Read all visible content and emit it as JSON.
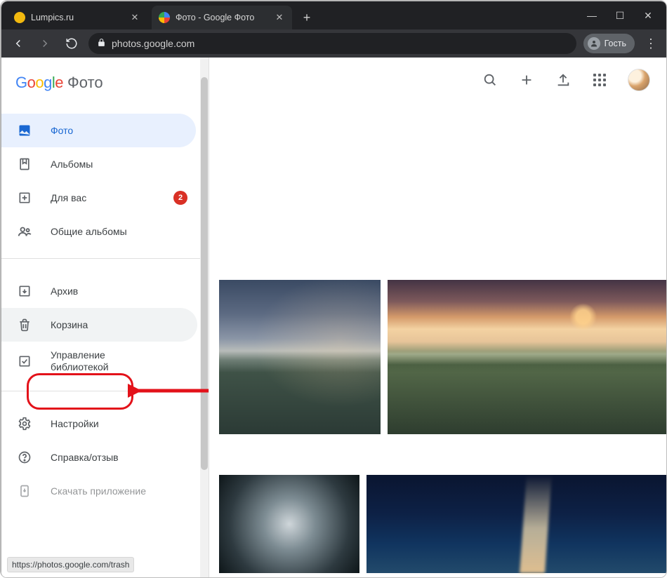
{
  "window": {
    "tabs": [
      {
        "title": "Lumpics.ru",
        "favicon_color": "#f2b90f"
      },
      {
        "title": "Фото - Google Фото",
        "favicon_color": "#ffffff"
      }
    ],
    "controls": {
      "min": "—",
      "max": "☐",
      "close": "✕"
    },
    "newtab": "+"
  },
  "address": {
    "back": "←",
    "forward": "→",
    "reload": "⟳",
    "lock": "🔒",
    "url": "photos.google.com",
    "guest_label": "Гость",
    "menu_glyph": "⋮"
  },
  "app": {
    "logo_primary": "Google",
    "logo_secondary": "Фото",
    "header_icons": {
      "search": "search-icon",
      "add": "add-icon",
      "upload": "upload-icon",
      "apps": "apps-icon",
      "avatar": "avatar"
    }
  },
  "sidebar": {
    "items": [
      {
        "label": "Фото",
        "icon": "image-icon",
        "active": true
      },
      {
        "label": "Альбомы",
        "icon": "bookmark-icon"
      },
      {
        "label": "Для вас",
        "icon": "plus-box-icon",
        "badge": "2"
      },
      {
        "label": "Общие альбомы",
        "icon": "group-icon"
      }
    ],
    "items2": [
      {
        "label": "Архив",
        "icon": "archive-icon"
      },
      {
        "label": "Корзина",
        "icon": "trash-icon",
        "highlighted": true
      },
      {
        "label": "Управление библиотекой",
        "icon": "check-box-icon"
      }
    ],
    "items3": [
      {
        "label": "Настройки",
        "icon": "gear-icon"
      },
      {
        "label": "Справка/отзыв",
        "icon": "help-icon"
      },
      {
        "label": "Скачать приложение",
        "icon": "download-icon"
      }
    ]
  },
  "status_bar": "https://photos.google.com/trash",
  "colors": {
    "accent": "#1a73e8",
    "badge": "#d93025",
    "annotation": "#e3121a"
  }
}
